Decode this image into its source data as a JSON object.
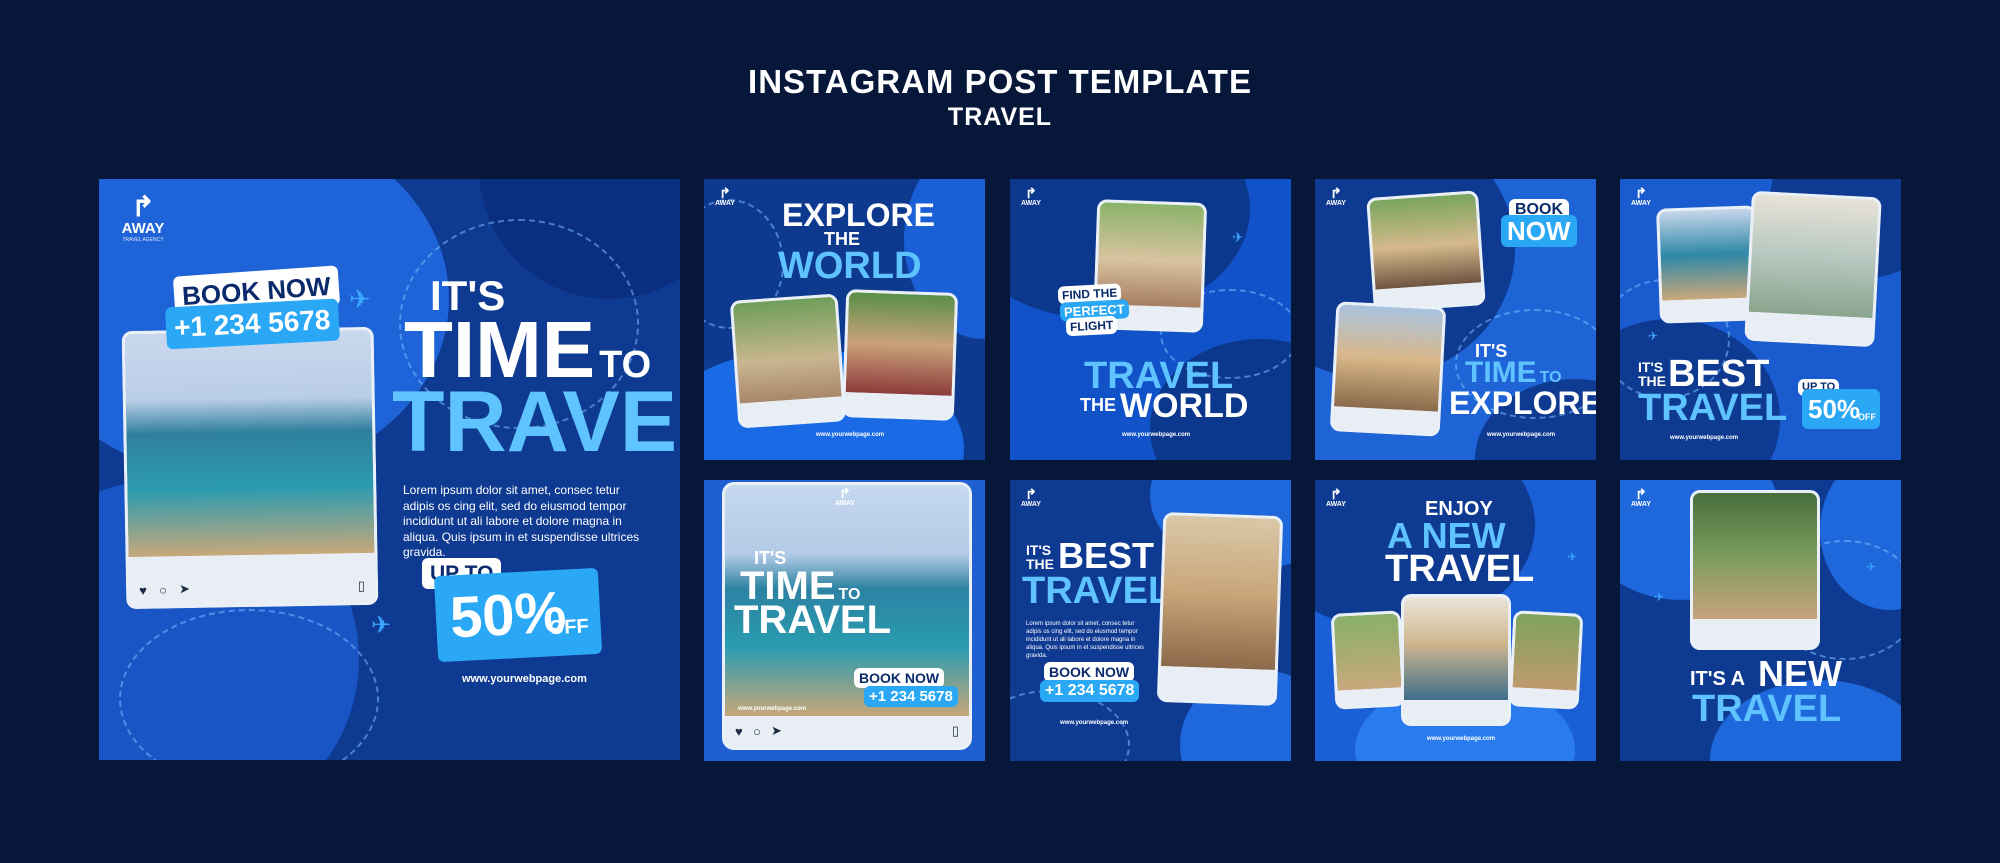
{
  "header": {
    "title": "INSTAGRAM POST TEMPLATE",
    "subtitle": "TRAVEL"
  },
  "brand": {
    "name": "AWAY",
    "tagline": "TRAVEL AGENCY"
  },
  "colors": {
    "background": "#06173a",
    "card": "#0d3a8f",
    "accent": "#2aa8f5",
    "accent_light": "#5fc3ff"
  },
  "icons": [
    "airplane-icon",
    "heart-icon",
    "comment-icon",
    "send-icon",
    "bookmark-icon"
  ],
  "url": "www.yourwebpage.com",
  "p1": {
    "book": "BOOK NOW",
    "phone": "+1 234 5678",
    "its": "IT'S",
    "time": "TIME",
    "to": "TO",
    "travel": "TRAVEL",
    "lorem": "Lorem ipsum dolor sit amet, consec tetur adipis os cing elit, sed do eiusmod tempor incididunt ut ali labore et dolore magna in aliqua. Quis ipsum in et suspendisse ultrices gravida.",
    "upto": "UP TO",
    "pct": "50%",
    "off": "OFF"
  },
  "p2": {
    "explore": "EXPLORE",
    "the": "THE",
    "world": "WORLD"
  },
  "p3": {
    "find": "FIND THE",
    "perfect": "PERFECT",
    "flight": "FLIGHT",
    "travel": "TRAVEL",
    "the": "THE",
    "world": "WORLD"
  },
  "p4": {
    "book": "BOOK",
    "now": "NOW",
    "its": "IT'S",
    "time": "TIME",
    "to": "TO",
    "explore": "EXPLORE"
  },
  "p5": {
    "its": "IT'S",
    "the": "THE",
    "best": "BEST",
    "travel": "TRAVEL",
    "upto": "UP TO",
    "pct": "50%",
    "off": "OFF"
  },
  "p6": {
    "its": "IT'S",
    "time": "TIME",
    "to": "TO",
    "travel": "TRAVEL",
    "book": "BOOK NOW",
    "phone": "+1 234 5678"
  },
  "p7": {
    "its": "IT'S",
    "the": "THE",
    "best": "BEST",
    "travel": "TRAVEL",
    "book": "BOOK NOW",
    "phone": "+1 234 5678"
  },
  "p8": {
    "enjoy": "ENJOY",
    "anew": "A NEW",
    "travel": "TRAVEL"
  },
  "p9": {
    "its": "IT'S A",
    "new": "NEW",
    "travel": "TRAVEL"
  }
}
